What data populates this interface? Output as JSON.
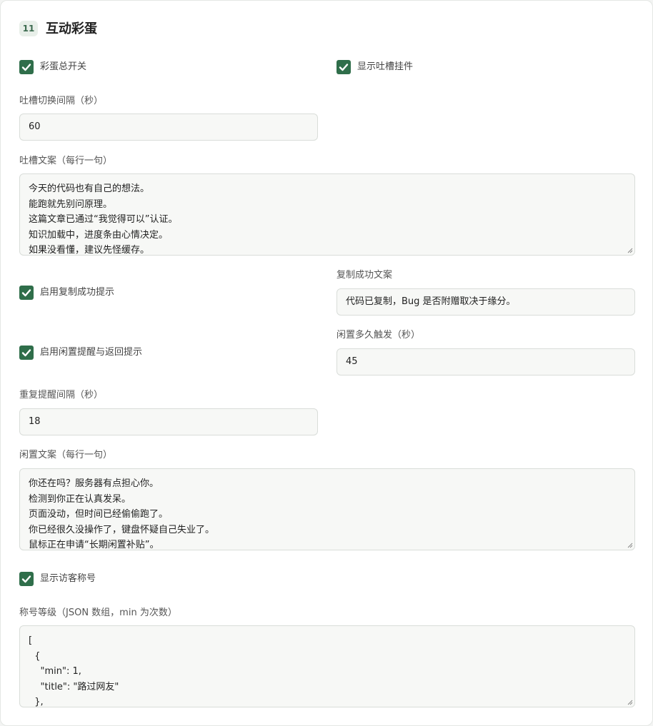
{
  "section": {
    "number": "11",
    "title": "互动彩蛋"
  },
  "toggles": {
    "master": {
      "label": "彩蛋总开关",
      "checked": true
    },
    "show_widget": {
      "label": "显示吐槽挂件",
      "checked": true
    },
    "copy_tip": {
      "label": "启用复制成功提示",
      "checked": true
    },
    "idle_tip": {
      "label": "启用闲置提醒与返回提示",
      "checked": true
    },
    "visitor_title": {
      "label": "显示访客称号",
      "checked": true
    }
  },
  "fields": {
    "quip_interval": {
      "label": "吐槽切换间隔（秒）",
      "value": "60"
    },
    "quip_text": {
      "label": "吐槽文案（每行一句）",
      "lines": [
        "今天的代码也有自己的想法。",
        "能跑就先别问原理。",
        "这篇文章已通过“我觉得可以”认证。",
        "知识加载中，进度条由心情决定。",
        "如果没看懂，建议先怪缓存。"
      ]
    },
    "copy_text": {
      "label": "复制成功文案",
      "value": "代码已复制，Bug 是否附赠取决于缘分。"
    },
    "idle_delay": {
      "label": "闲置多久触发（秒）",
      "value": "45"
    },
    "repeat_interval": {
      "label": "重复提醒间隔（秒）",
      "value": "18"
    },
    "idle_text": {
      "label": "闲置文案（每行一句）",
      "lines": [
        "你还在吗？服务器有点担心你。",
        "检测到你正在认真发呆。",
        "页面没动，但时间已经偷偷跑了。",
        "你已经很久没操作了，键盘怀疑自己失业了。",
        "鼠标正在申请“长期闲置补贴”。"
      ]
    },
    "levels": {
      "label": "称号等级（JSON 数组，min 为次数）",
      "lines": [
        "[",
        "  {",
        "    \"min\": 1,",
        "    \"title\": \"路过网友\"",
        "  },"
      ]
    }
  },
  "colors": {
    "accent": "#2f6e4a",
    "input_bg": "#f7f8f6",
    "border": "#d9ddd9"
  }
}
